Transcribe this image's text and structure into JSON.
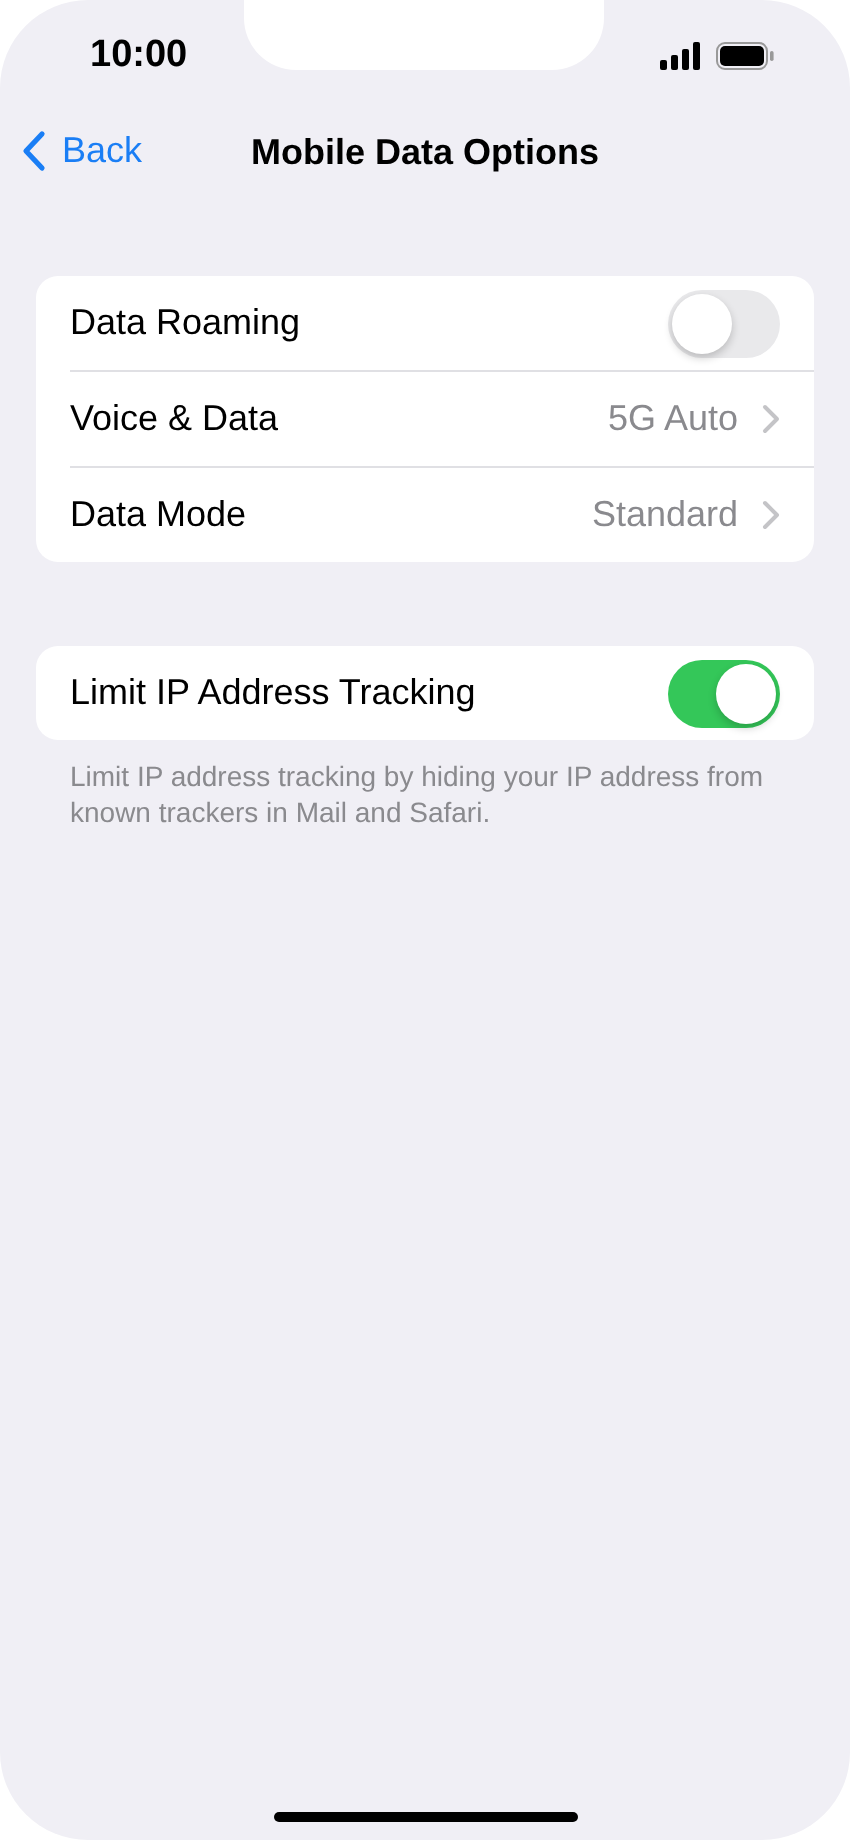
{
  "status_bar": {
    "time": "10:00"
  },
  "nav": {
    "back": "Back",
    "title": "Mobile Data Options"
  },
  "groups": [
    {
      "rows": [
        {
          "kind": "toggle",
          "label": "Data Roaming",
          "on": false
        },
        {
          "kind": "link",
          "label": "Voice & Data",
          "value": "5G Auto"
        },
        {
          "kind": "link",
          "label": "Data Mode",
          "value": "Standard"
        }
      ]
    },
    {
      "rows": [
        {
          "kind": "toggle",
          "label": "Limit IP Address Tracking",
          "on": true
        }
      ],
      "footer": "Limit IP address tracking by hiding your IP address from known trackers in Mail and Safari."
    }
  ]
}
